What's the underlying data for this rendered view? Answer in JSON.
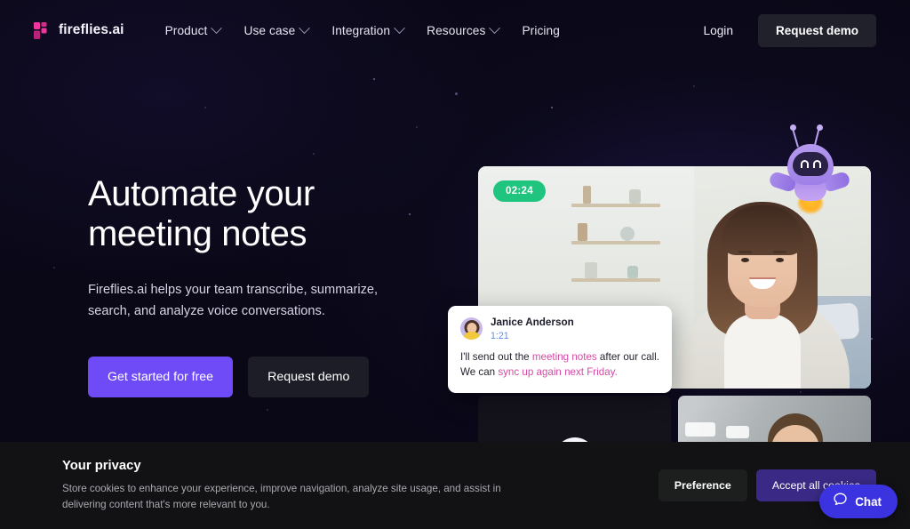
{
  "nav": {
    "brand": {
      "name": "fireflies.ai",
      "icon": "fireflies-logo-icon",
      "color": "#e0359b"
    },
    "links": [
      {
        "label": "Product",
        "has_dropdown": true
      },
      {
        "label": "Use case",
        "has_dropdown": true
      },
      {
        "label": "Integration",
        "has_dropdown": true
      },
      {
        "label": "Resources",
        "has_dropdown": true
      },
      {
        "label": "Pricing",
        "has_dropdown": false
      }
    ],
    "login_label": "Login",
    "demo_label": "Request demo"
  },
  "hero": {
    "title": "Automate your\nmeeting notes",
    "subtitle": "Fireflies.ai helps your team transcribe, summarize, search, and analyze voice conversations.",
    "primary_cta": "Get started for free",
    "secondary_cta": "Request demo",
    "primary_color": "#6f4bf7"
  },
  "meeting": {
    "timer": "02:24",
    "timer_color": "#1fc47e",
    "transcript": {
      "speaker": "Janice Anderson",
      "timestamp": "1:21",
      "line1_pre": "I'll send out the ",
      "line1_highlight": "meeting notes",
      "line1_post": " after our call.",
      "line2_pre": "We can ",
      "line2_highlight": "sync up again next Friday.",
      "highlight_color": "#d14ba4"
    },
    "mascot": "fireflies-robot-mascot-icon"
  },
  "cookie": {
    "title": "Your privacy",
    "body": "Store cookies to enhance your experience, improve navigation, analyze site usage, and assist in delivering content that's more relevant to you.",
    "preference_label": "Preference",
    "accept_label": "Accept all cookies",
    "accept_color": "#3a2a86"
  },
  "chat": {
    "label": "Chat",
    "icon": "chat-bubble-icon",
    "color": "#3b33e0"
  }
}
